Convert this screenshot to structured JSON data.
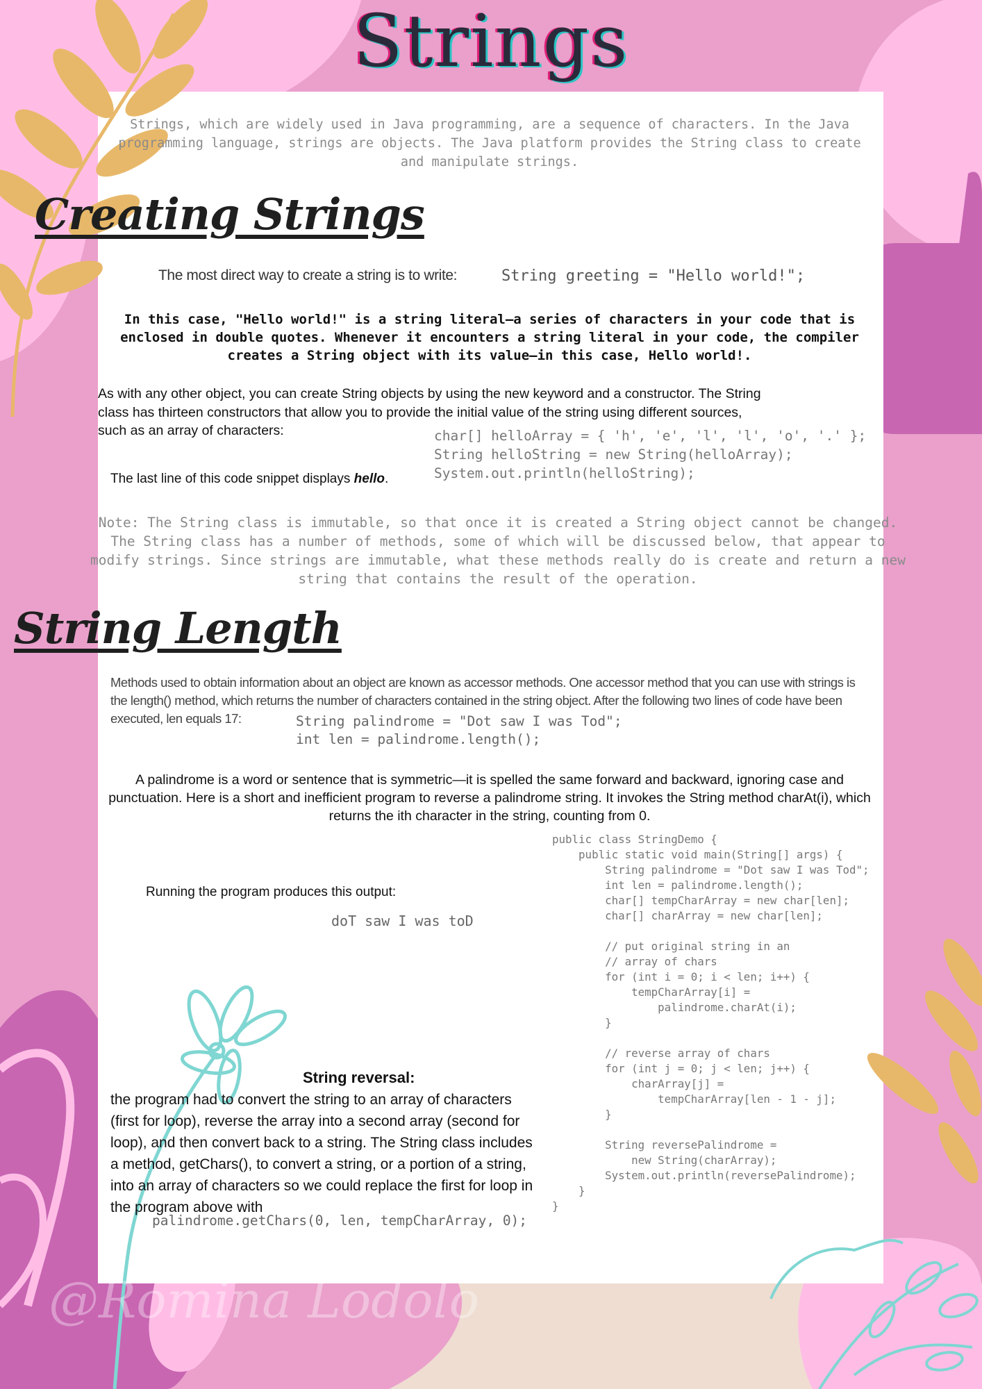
{
  "title": "Strings",
  "intro": "Strings, which are widely used in Java programming, are a sequence of characters. In the Java programming language, strings are objects. The Java platform provides the String class to create and manipulate strings.",
  "sections": {
    "creating": {
      "heading": "Creating Strings",
      "lead": "The most direct way to create a string is to write:",
      "code_greeting": "String greeting = \"Hello world!\";",
      "literal_text": "In this case, \"Hello world!\" is a string literal—a series of characters in your code that is enclosed in double quotes. Whenever it encounters a string literal in your code, the compiler creates a String object with its value—in this case, Hello world!.",
      "constructors_text": "As with any other object, you can create String objects by using the new keyword and a constructor. The String class has thirteen constructors that allow you to provide the initial value of the string using different sources, such as an array of characters:",
      "code_array": "char[] helloArray = { 'h', 'e', 'l', 'l', 'o', '.' };\nString helloString = new String(helloArray);\nSystem.out.println(helloString);",
      "last_line_prefix": "The last line of this code snippet displays ",
      "last_line_emph": "hello",
      "last_line_suffix": ".",
      "note": "Note: The String class is immutable, so that once it is created a String object cannot be changed. The String class has a number of methods, some of which will be discussed below, that appear to modify strings. Since strings are immutable, what these methods really do is create and return a new string that contains the result of the operation."
    },
    "length": {
      "heading": "String Length",
      "methods_text": "Methods used to obtain information about an object are known as accessor methods. One accessor method that you can use with strings is the length() method, which returns the number of characters contained in the string object. After the following two lines of code have been executed, len equals 17:",
      "code_palindrome": "String palindrome = \"Dot saw I was Tod\";\nint len = palindrome.length();",
      "palindrome_text": "A palindrome is a word or sentence that is symmetric—it is spelled the same forward and backward, ignoring case and punctuation. Here is a short and inefficient program to reverse a palindrome string. It invokes the String method charAt(i), which returns the ith character in the string, counting from 0.",
      "running_text": "Running the program produces this output:",
      "output": "doT saw I was toD",
      "code_demo": "public class StringDemo {\n    public static void main(String[] args) {\n        String palindrome = \"Dot saw I was Tod\";\n        int len = palindrome.length();\n        char[] tempCharArray = new char[len];\n        char[] charArray = new char[len];\n\n        // put original string in an\n        // array of chars\n        for (int i = 0; i < len; i++) {\n            tempCharArray[i] =\n                palindrome.charAt(i);\n        }\n\n        // reverse array of chars\n        for (int j = 0; j < len; j++) {\n            charArray[j] =\n                tempCharArray[len - 1 - j];\n        }\n\n        String reversePalindrome =\n            new String(charArray);\n        System.out.println(reversePalindrome);\n    }\n}",
      "reversal_title": "String reversal:",
      "reversal_text": "the program had to convert the string to an array of characters (first for loop), reverse the array into a second array (second for loop), and then convert back to a string. The String class includes a method, getChars(), to convert a string, or a portion of a string, into an array of characters so we could replace the first for loop in the program above with",
      "code_getchars": "palindrome.getChars(0, len, tempCharArray, 0);"
    }
  },
  "watermark": "@Romina Lodolo",
  "colors": {
    "background": "#eaa0cb",
    "light_pink": "#ffbde6",
    "magenta": "#c866b2",
    "leaf_gold": "#e8b86a",
    "flower_teal": "#7fd6d2",
    "sand": "#efddd2",
    "paper": "#ffffff"
  },
  "icons": [
    "leaf-branch-icon",
    "flower-line-icon",
    "plant-line-icon"
  ]
}
